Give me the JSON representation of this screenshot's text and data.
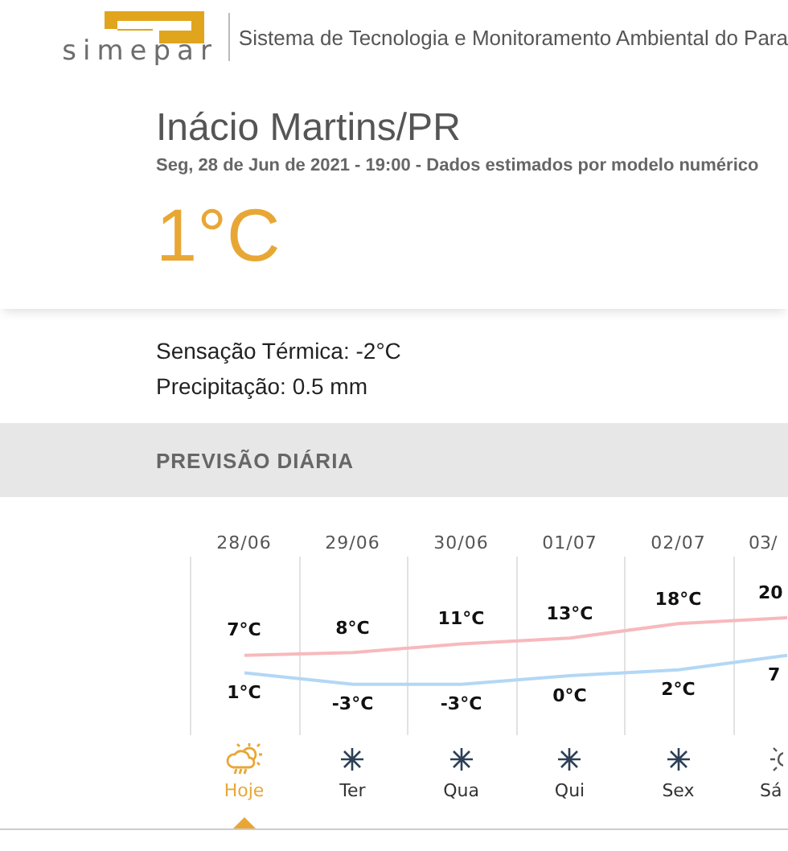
{
  "header": {
    "logo_text": "simepar",
    "title": "Sistema de Tecnologia e Monitoramento Ambiental do Para"
  },
  "location": {
    "title": "Inácio Martins/PR",
    "subtitle": "Seg, 28 de Jun de 2021 - 19:00 - Dados estimados por modelo numérico",
    "temperature": "1°C"
  },
  "details": [
    "Sensação Térmica: -2°C",
    "Precipitação: 0.5 mm"
  ],
  "forecast": {
    "title": "PREVISÃO DIÁRIA",
    "days": [
      {
        "date": "28/06",
        "weekday": "Hoje",
        "kind": "rain-sun",
        "selected": true
      },
      {
        "date": "29/06",
        "weekday": "Ter",
        "kind": "clear",
        "selected": false
      },
      {
        "date": "30/06",
        "weekday": "Qua",
        "kind": "clear",
        "selected": false
      },
      {
        "date": "01/07",
        "weekday": "Qui",
        "kind": "clear",
        "selected": false
      },
      {
        "date": "02/07",
        "weekday": "Sex",
        "kind": "clear",
        "selected": false
      },
      {
        "date": "03/",
        "weekday": "Sá",
        "kind": "sun",
        "selected": false
      }
    ],
    "chart_data": {
      "type": "line",
      "series": [
        {
          "color": "#f7b9bd",
          "values": [
            7,
            8,
            11,
            13,
            18,
            20
          ],
          "value_labels": [
            "7°C",
            "8°C",
            "11°C",
            "13°C",
            "18°C",
            "20"
          ]
        },
        {
          "color": "#b3d7f5",
          "values": [
            1,
            -3,
            -3,
            0,
            2,
            7
          ],
          "value_labels": [
            "1°C",
            "-3°C",
            "-3°C",
            "0°C",
            "2°C",
            "7"
          ]
        }
      ]
    }
  }
}
